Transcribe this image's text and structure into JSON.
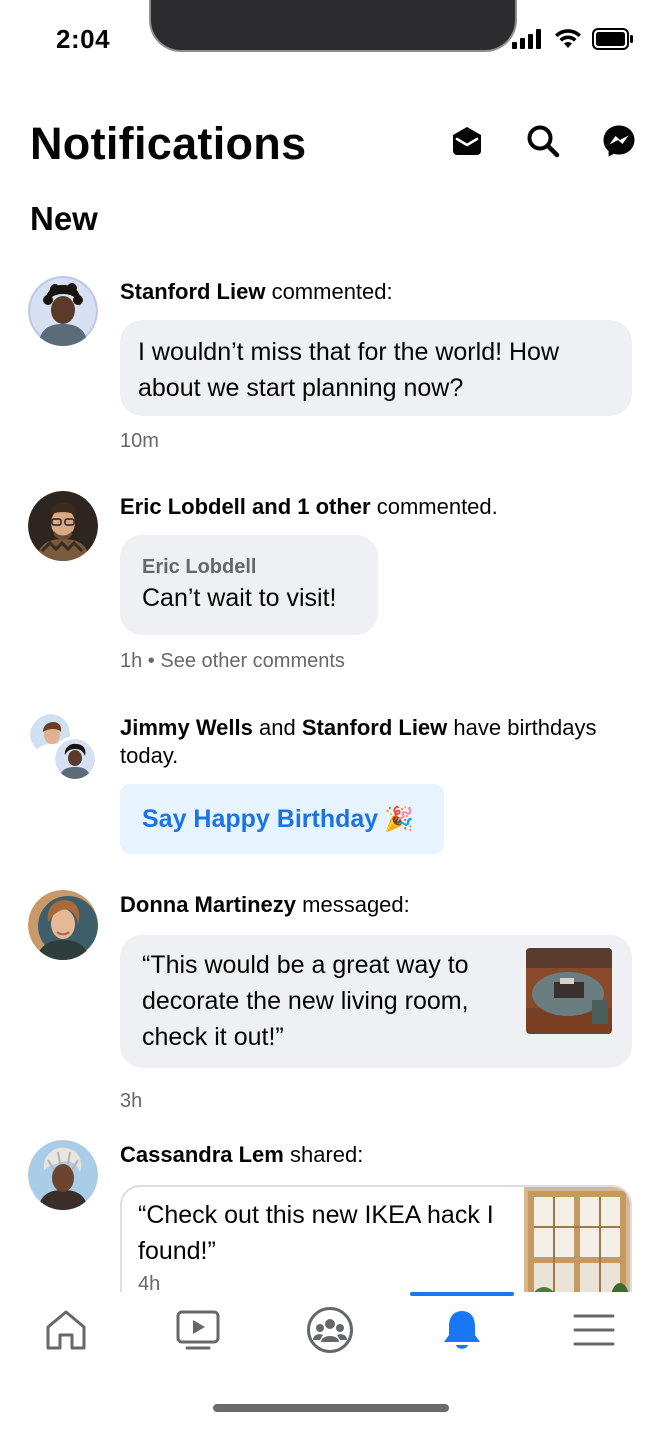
{
  "status_bar": {
    "time": "2:04"
  },
  "header": {
    "title": "Notifications",
    "icons": [
      "mark-read-icon",
      "search-icon",
      "messenger-icon"
    ]
  },
  "section": {
    "title": "New"
  },
  "notifications": [
    {
      "actor": "Stanford Liew",
      "action": " commented:",
      "comment": "I wouldn’t miss that for the world! How about we start planning now?",
      "time": "10m"
    },
    {
      "actor": "Eric Lobdell and 1 other",
      "action": " commented.",
      "comment_author": "Eric Lobdell",
      "comment": "Can’t wait to visit!",
      "time": "1h",
      "separator": " • ",
      "see_more": "See other comments"
    },
    {
      "actor1": "Jimmy Wells",
      "and": " and ",
      "actor2": "Stanford Liew",
      "action": " have birthdays today.",
      "button_label": "Say Happy Birthday",
      "button_emoji": "🎉"
    },
    {
      "actor": "Donna Martinezy",
      "action": " messaged:",
      "message": "“This would be a great way to decorate the new living room, check it out!”",
      "time": "3h"
    },
    {
      "actor": "Cassandra Lem",
      "action": " shared:",
      "quote": "“Check out this new IKEA hack I found!”",
      "time": "4h"
    }
  ],
  "tab_bar": {
    "tabs": [
      "home-icon",
      "video-icon",
      "groups-icon",
      "notifications-icon",
      "menu-icon"
    ],
    "active": "notifications-icon",
    "active_color": "#1877f2"
  },
  "colors": {
    "bubble": "#eff0f4",
    "accent": "#1877f2",
    "button_bg": "#e7f3ff",
    "meta": "#65676b"
  }
}
